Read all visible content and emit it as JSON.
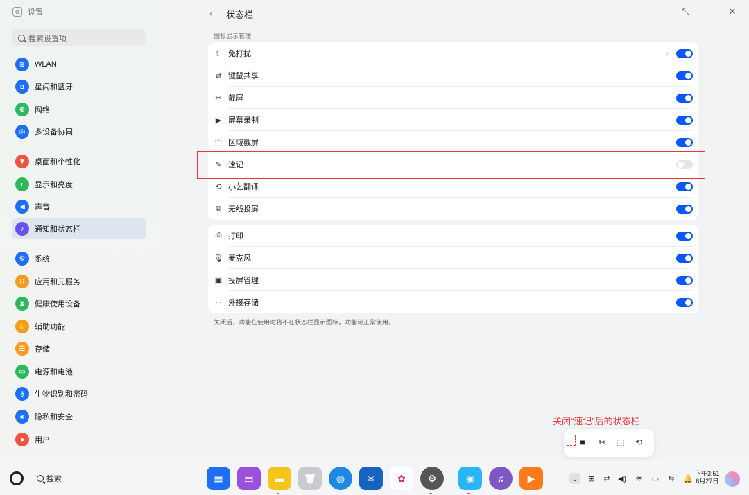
{
  "window": {
    "app_title": "设置",
    "page_title": "状态栏"
  },
  "sidebar": {
    "search_placeholder": "搜索设置项",
    "items": [
      {
        "label": "WLAN",
        "icon": "wifi-icon",
        "color": "#1e6ff5"
      },
      {
        "label": "星闪和蓝牙",
        "icon": "bluetooth-icon",
        "color": "#1e6ff5"
      },
      {
        "label": "网络",
        "icon": "globe-icon",
        "color": "#2eb85c"
      },
      {
        "label": "多设备协同",
        "icon": "devices-icon",
        "color": "#1e6ff5"
      },
      {
        "label": "桌面和个性化",
        "icon": "brush-icon",
        "color": "#f0533f"
      },
      {
        "label": "显示和亮度",
        "icon": "display-icon",
        "color": "#2eb85c"
      },
      {
        "label": "声音",
        "icon": "speaker-icon",
        "color": "#1e6ff5"
      },
      {
        "label": "通知和状态栏",
        "icon": "bell-icon",
        "color": "#6a4ff2"
      },
      {
        "label": "系统",
        "icon": "system-icon",
        "color": "#1e6ff5"
      },
      {
        "label": "应用和元服务",
        "icon": "apps-icon",
        "color": "#f59b20"
      },
      {
        "label": "健康使用设备",
        "icon": "hourglass-icon",
        "color": "#2eb85c"
      },
      {
        "label": "辅助功能",
        "icon": "hand-icon",
        "color": "#f59b20"
      },
      {
        "label": "存储",
        "icon": "storage-icon",
        "color": "#f59b20"
      },
      {
        "label": "电源和电池",
        "icon": "battery-icon",
        "color": "#2eb85c"
      },
      {
        "label": "生物识别和密码",
        "icon": "key-icon",
        "color": "#1e6ff5"
      },
      {
        "label": "隐私和安全",
        "icon": "shield-icon",
        "color": "#1e6ff5"
      },
      {
        "label": "用户",
        "icon": "user-icon",
        "color": "#f0533f"
      }
    ]
  },
  "main": {
    "section_label": "图标显示管理",
    "group1": [
      {
        "label": "免打扰",
        "icon": "moon-icon",
        "on": true,
        "has_chevron": true
      },
      {
        "label": "键鼠共享",
        "icon": "keyboard-mouse-share-icon",
        "on": true
      },
      {
        "label": "截屏",
        "icon": "screenshot-icon",
        "on": true
      },
      {
        "label": "屏幕录制",
        "icon": "screen-record-icon",
        "on": true
      },
      {
        "label": "区域截屏",
        "icon": "area-screenshot-icon",
        "on": true
      },
      {
        "label": "速记",
        "icon": "note-icon",
        "on": false
      },
      {
        "label": "小艺翻译",
        "icon": "translate-icon",
        "on": true
      },
      {
        "label": "无线投屏",
        "icon": "cast-icon",
        "on": true
      }
    ],
    "group2": [
      {
        "label": "打印",
        "icon": "printer-icon",
        "on": true
      },
      {
        "label": "麦克风",
        "icon": "microphone-icon",
        "on": true
      },
      {
        "label": "投屏管理",
        "icon": "cast-manage-icon",
        "on": true
      },
      {
        "label": "外接存储",
        "icon": "external-storage-icon",
        "on": true
      }
    ],
    "hint": "关闭后，功能在使用时将不在状态栏显示图标，功能可正常使用。"
  },
  "annotation": {
    "text": "关闭“速记”后的状态栏",
    "highlight_color": "#e53935"
  },
  "taskbar": {
    "search_label": "搜索",
    "time": "下午3:51",
    "date": "6月27日"
  }
}
